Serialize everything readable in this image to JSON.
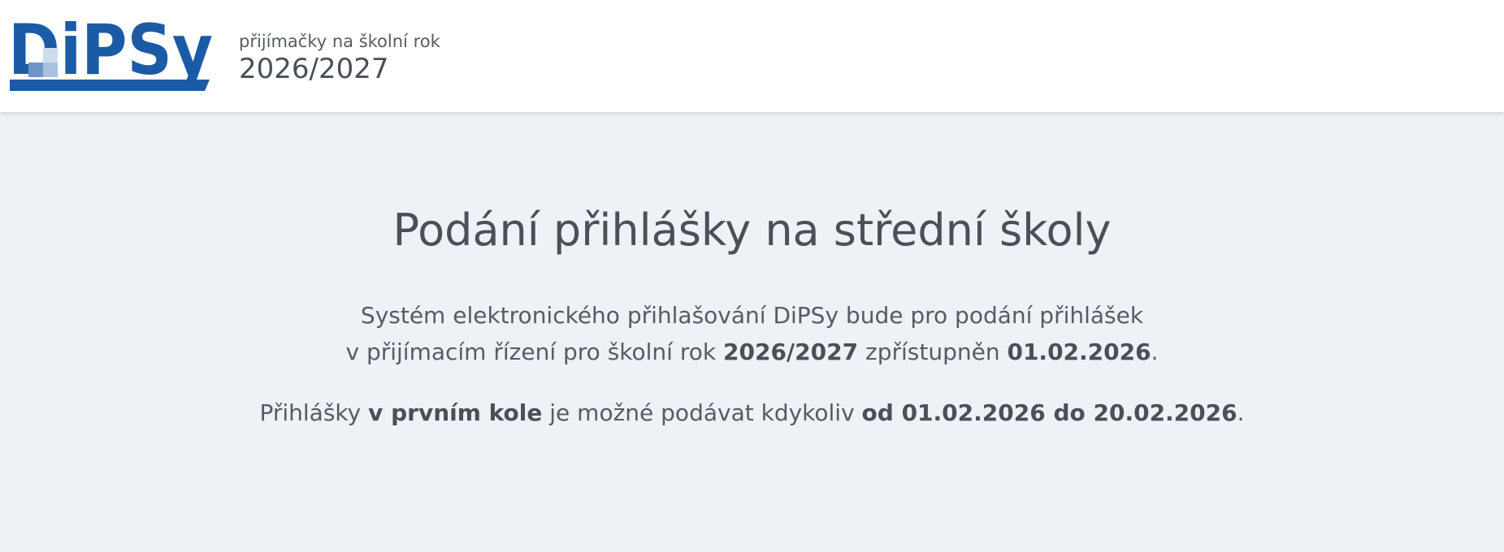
{
  "header": {
    "logo_text": "DiPSy",
    "year_caption": "přijímačky na školní rok",
    "year_value": "2026/2027",
    "brand_color": "#1b5ba6"
  },
  "main": {
    "title": "Podání přihlášky na střední školy",
    "line1": "Systém elektronického přihlašování DiPSy bude pro podání přihlášek",
    "line2_a": "v přijímacím řízení pro školní rok ",
    "line2_year": "2026/2027",
    "line2_b": " zpřístupněn ",
    "line2_date": "01.02.2026",
    "line2_end": ".",
    "line3_a": "Přihlášky ",
    "line3_round": "v prvním kole",
    "line3_b": " je možné podávat kdykoliv ",
    "line3_range": "od 01.02.2026 do 20.02.2026",
    "line3_end": "."
  }
}
